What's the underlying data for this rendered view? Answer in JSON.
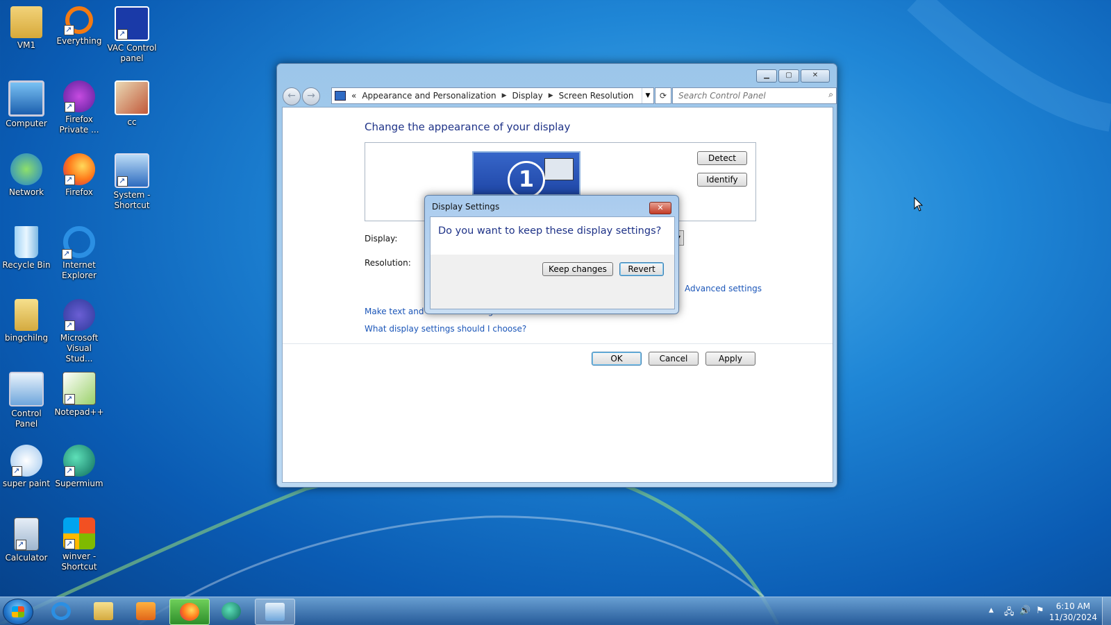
{
  "desktop": {
    "icons": [
      {
        "label": "VM1",
        "icon": "folder-user-icon"
      },
      {
        "label": "Everything",
        "icon": "everything-search-icon"
      },
      {
        "label": "VAC Control panel",
        "icon": "vac-control-icon"
      },
      {
        "label": "Computer",
        "icon": "computer-icon"
      },
      {
        "label": "Firefox Private ...",
        "icon": "firefox-private-icon"
      },
      {
        "label": "cc",
        "icon": "cc-image-icon"
      },
      {
        "label": "Network",
        "icon": "network-icon"
      },
      {
        "label": "Firefox",
        "icon": "firefox-icon"
      },
      {
        "label": "System - Shortcut",
        "icon": "system-icon"
      },
      {
        "label": "Recycle Bin",
        "icon": "recycle-bin-icon"
      },
      {
        "label": "Internet Explorer",
        "icon": "internet-explorer-icon"
      },
      {
        "label": "bingchilng",
        "icon": "folder-icon"
      },
      {
        "label": "Microsoft Visual Stud...",
        "icon": "visual-studio-icon"
      },
      {
        "label": "Control Panel",
        "icon": "control-panel-icon"
      },
      {
        "label": "Notepad++",
        "icon": "notepadpp-icon"
      },
      {
        "label": "super paint",
        "icon": "paint-icon"
      },
      {
        "label": "Supermium",
        "icon": "supermium-icon"
      },
      {
        "label": "Calculator",
        "icon": "calculator-icon"
      },
      {
        "label": "winver - Shortcut",
        "icon": "windows-logo-icon"
      }
    ]
  },
  "control_panel": {
    "breadcrumb": {
      "overflow": "«",
      "items": [
        "Appearance and Personalization",
        "Display",
        "Screen Resolution"
      ]
    },
    "search_placeholder": "Search Control Panel",
    "heading": "Change the appearance of your display",
    "monitor_number": "1",
    "detect_label": "Detect",
    "identify_label": "Identify",
    "display_label": "Display:",
    "resolution_label": "Resolution:",
    "advanced_link": "Advanced settings",
    "text_size_link": "Make text and other items larger or smaller",
    "choose_link": "What display settings should I choose?",
    "ok_label": "OK",
    "cancel_label": "Cancel",
    "apply_label": "Apply"
  },
  "dialog": {
    "title": "Display Settings",
    "question": "Do you want to keep these display settings?",
    "keep_label": "Keep changes",
    "revert_label": "Revert"
  },
  "taskbar": {
    "apps": [
      "internet-explorer",
      "file-explorer",
      "media-player",
      "firefox",
      "supermium",
      "control-panel"
    ],
    "time": "6:10 AM",
    "date": "11/30/2024"
  }
}
